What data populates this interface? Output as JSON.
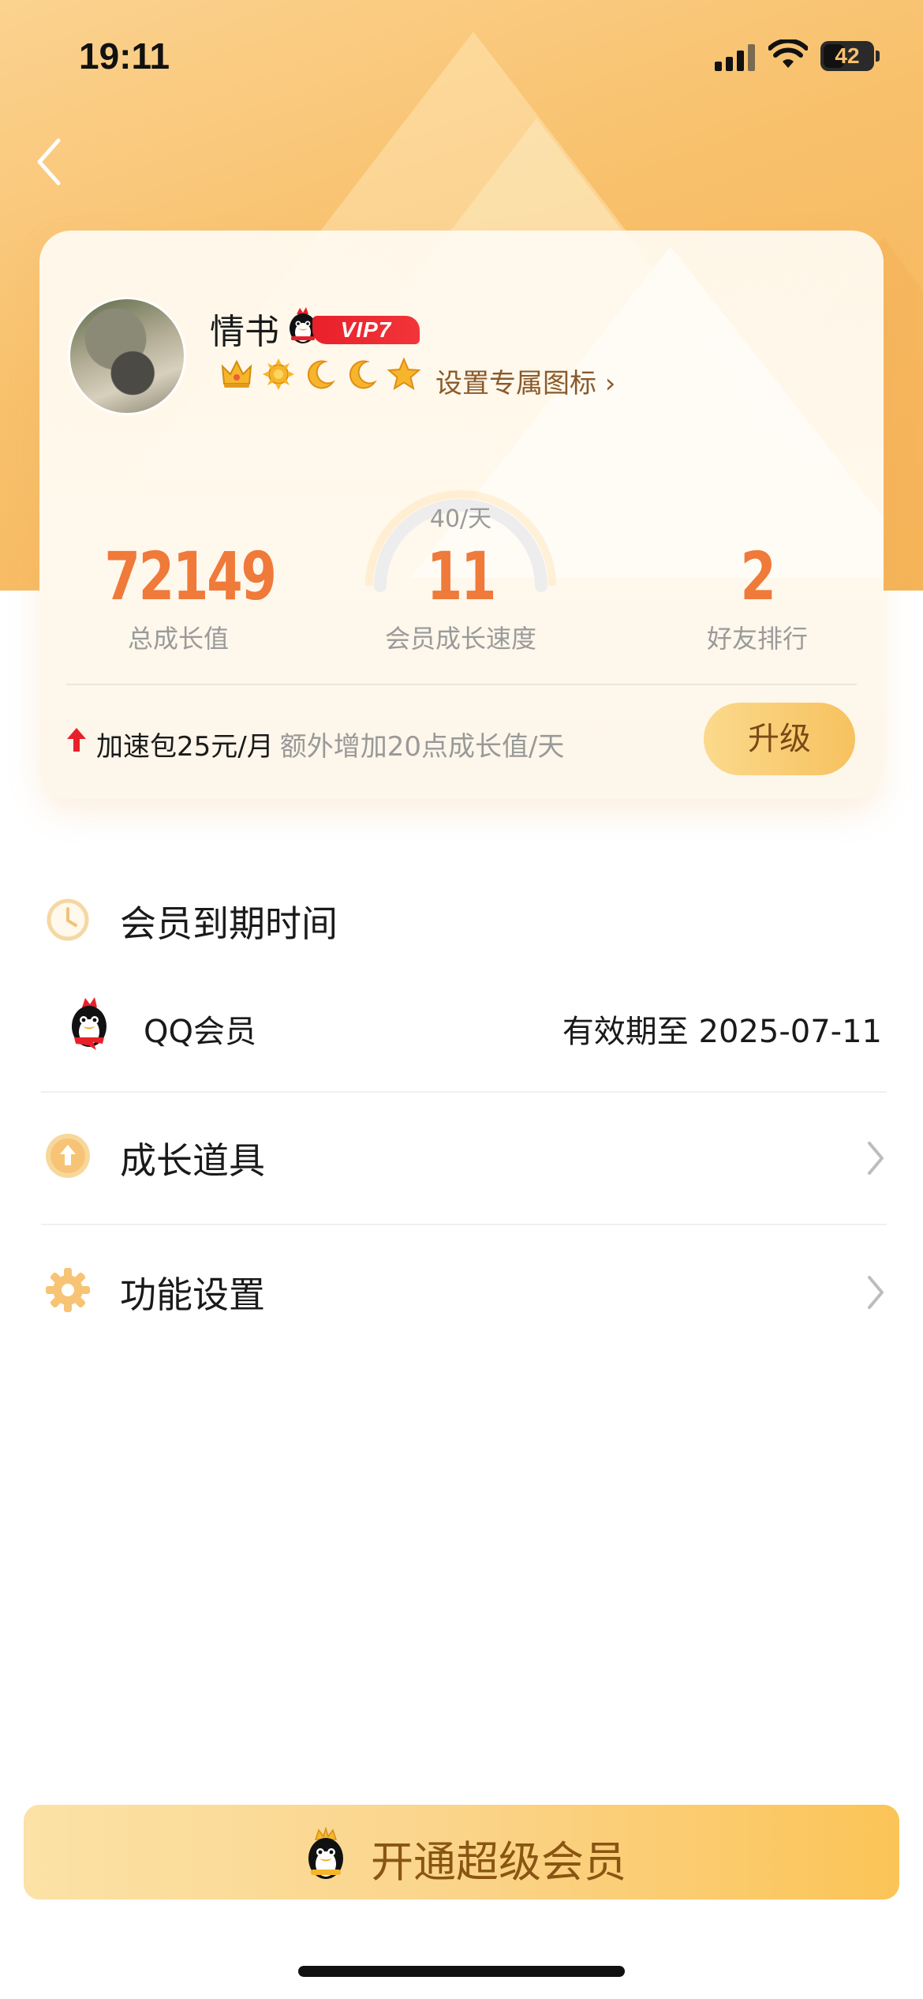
{
  "status_bar": {
    "time": "19:11",
    "battery": "42"
  },
  "profile": {
    "name": "情书",
    "vip_tag": "VIP7",
    "level_icons": [
      "crown-icon",
      "sun-icon",
      "moon-icon",
      "moon-icon",
      "star-icon"
    ],
    "custom_icon_link": "设置专属图标"
  },
  "stats": {
    "total_growth": {
      "value": "72149",
      "label": "总成长值"
    },
    "growth_speed": {
      "value": "11",
      "label": "会员成长速度",
      "rate": "40/天"
    },
    "friend_rank": {
      "value": "2",
      "label": "好友排行"
    }
  },
  "boost": {
    "title": "加速包25元/月",
    "subtitle": "额外增加20点成长值/天",
    "upgrade_label": "升级"
  },
  "expiry_section": {
    "title": "会员到期时间",
    "membership": {
      "name": "QQ会员",
      "validity": "有效期至 2025-07-11"
    }
  },
  "menu": {
    "growth_tools": "成长道具",
    "function_settings": "功能设置"
  },
  "bottom": {
    "open_svip": "开通超级会员"
  },
  "colors": {
    "accent_orange": "#ef7a3a",
    "gold": "#f7c25f",
    "header_bg": "#f8c06b",
    "vip_red": "#e8202a"
  }
}
